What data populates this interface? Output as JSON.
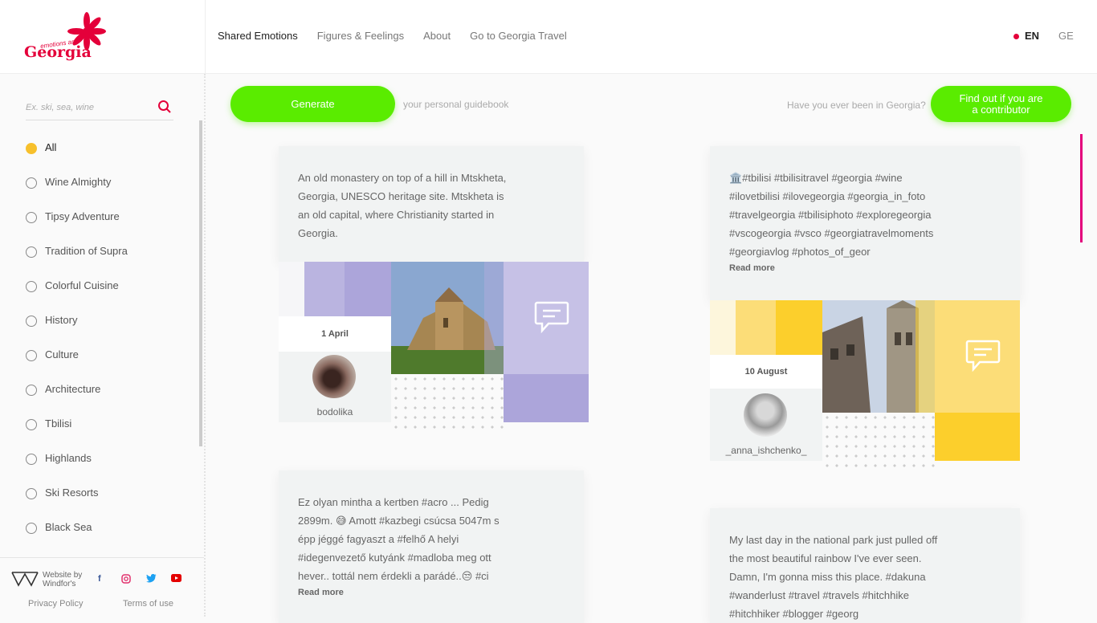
{
  "brand": {
    "small": "emotions are",
    "name": "Georgia",
    "color": "#e4003a"
  },
  "nav": {
    "items": [
      "Shared Emotions",
      "Figures & Feelings",
      "About",
      "Go to Georgia Travel"
    ]
  },
  "lang": {
    "en": "EN",
    "ge": "GE"
  },
  "search": {
    "placeholder": "Ex. ski, sea, wine",
    "icon": "search-icon"
  },
  "categories": [
    "All",
    "Wine Almighty",
    "Tipsy Adventure",
    "Tradition of Supra",
    "Colorful Cuisine",
    "History",
    "Culture",
    "Architecture",
    "Tbilisi",
    "Highlands",
    "Ski Resorts",
    "Black Sea"
  ],
  "footer": {
    "credit": "Website by Windfor's",
    "privacy": "Privacy Policy",
    "terms": "Terms of use",
    "social": [
      "f",
      "ig",
      "tw",
      "yt"
    ]
  },
  "actions": {
    "generate": "Generate",
    "generate_sub": "your personal guidebook",
    "been": "Have you ever been in Georgia?",
    "find_line1": "Find out if you are",
    "find_line2": "a contributor"
  },
  "posts": [
    {
      "text": [
        "An old monastery on top of a hill in Mtskheta,",
        "Georgia, UNESCO heritage site. Mtskheta is",
        "an old capital, where Christianity started in",
        "Georgia."
      ],
      "date": "1 April",
      "user": "bodolika",
      "accent": "#b4aede"
    },
    {
      "text": [
        "🏛️#tbilisi #tbilisitravel #georgia #wine",
        "#ilovetbilisi #ilovegeorgia #georgia_in_foto",
        "#travelgeorgia #tbilisiphoto #exploregeorgia",
        "#vscogeorgia #vsco #georgiatravelmoments",
        "#georgiavlog #photos_of_geor"
      ],
      "readmore": "Read more",
      "date": "10 August",
      "user": "_anna_ishchenko_",
      "accent": "#fccf2c"
    },
    {
      "text": [
        "Ez olyan mintha a kertben #acro ... Pedig",
        "2899m. 😅 Amott #kazbegi csúcsa 5047m s",
        "épp jéggé fagyaszt a #felhő A helyi",
        "#idegenvezető kutyánk #madloba meg ott",
        "hever.. tottál nem érdekli a parádé..😒 #ci"
      ],
      "readmore": "Read more"
    },
    {
      "text": [
        "My last day in the national park just pulled off",
        "the most beautiful rainbow I've ever seen.",
        "Damn, I'm gonna miss this place. #dakuna",
        "#wanderlust #travel #travels #hitchhike",
        "#hitchhiker #blogger #georg"
      ]
    }
  ]
}
